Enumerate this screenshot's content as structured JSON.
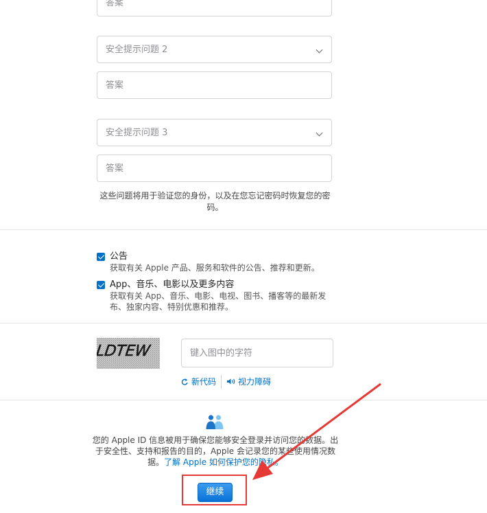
{
  "security": {
    "answer1_placeholder": "答案",
    "question2": "安全提示问题 2",
    "answer2_placeholder": "答案",
    "question3": "安全提示问题 3",
    "answer3_placeholder": "答案",
    "helper_text": "这些问题将用于验证您的身份，以及在您忘记密码时恢复您的密码。"
  },
  "subscriptions": {
    "items": [
      {
        "title": "公告",
        "description": "获取有关 Apple 产品、服务和软件的公告、推荐和更新。",
        "checked": true
      },
      {
        "title": "App、音乐、电影以及更多内容",
        "description": "获取有关 App、音乐、电影、电视、图书、播客等的最新发布、独家内容、特别优惠和推荐。",
        "checked": true
      }
    ]
  },
  "captcha": {
    "image_text": "LDTEW",
    "input_placeholder": "键入图中的字符",
    "new_code_label": "新代码",
    "vision_impaired_label": "视力障碍"
  },
  "privacy": {
    "text": "您的 Apple ID 信息被用于确保您能够安全登录并访问您的数据。出于安全性、支持和报告的目的，Apple 会记录您的某些使用情况数据。",
    "link_text": "了解 Apple 如何保护您的隐私。"
  },
  "continue_button": "继续",
  "annotation": {
    "color": "#e53935"
  },
  "accent_color": "#0070c9"
}
